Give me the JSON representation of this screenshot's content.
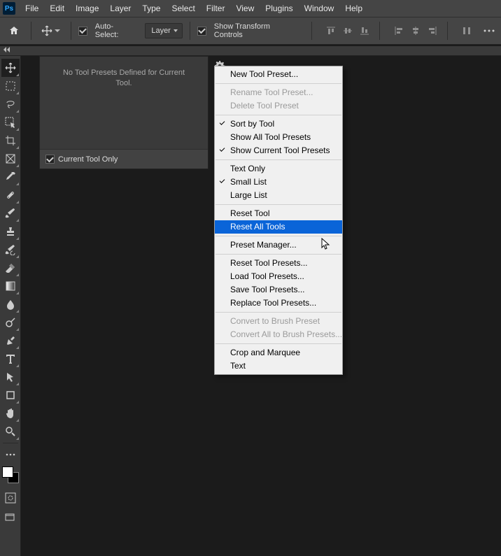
{
  "menubar": [
    "File",
    "Edit",
    "Image",
    "Layer",
    "Type",
    "Select",
    "Filter",
    "View",
    "Plugins",
    "Window",
    "Help"
  ],
  "optionsbar": {
    "auto_select_label": "Auto-Select:",
    "layer_dropdown": "Layer",
    "show_transform_label": "Show Transform Controls"
  },
  "preset_panel": {
    "empty_msg_line1": "No Tool Presets Defined for Current",
    "empty_msg_line2": "Tool.",
    "footer_checkbox": "Current Tool Only"
  },
  "context_menu": {
    "items": [
      {
        "label": "New Tool Preset...",
        "type": "item"
      },
      {
        "type": "sep"
      },
      {
        "label": "Rename Tool Preset...",
        "type": "item",
        "disabled": true
      },
      {
        "label": "Delete Tool Preset",
        "type": "item",
        "disabled": true
      },
      {
        "type": "sep"
      },
      {
        "label": "Sort by Tool",
        "type": "item",
        "checked": true
      },
      {
        "label": "Show All Tool Presets",
        "type": "item"
      },
      {
        "label": "Show Current Tool Presets",
        "type": "item",
        "checked": true
      },
      {
        "type": "sep"
      },
      {
        "label": "Text Only",
        "type": "item"
      },
      {
        "label": "Small List",
        "type": "item",
        "checked": true
      },
      {
        "label": "Large List",
        "type": "item"
      },
      {
        "type": "sep"
      },
      {
        "label": "Reset Tool",
        "type": "item"
      },
      {
        "label": "Reset All Tools",
        "type": "item",
        "highlight": true
      },
      {
        "type": "sep"
      },
      {
        "label": "Preset Manager...",
        "type": "item"
      },
      {
        "type": "sep"
      },
      {
        "label": "Reset Tool Presets...",
        "type": "item"
      },
      {
        "label": "Load Tool Presets...",
        "type": "item"
      },
      {
        "label": "Save Tool Presets...",
        "type": "item"
      },
      {
        "label": "Replace Tool Presets...",
        "type": "item"
      },
      {
        "type": "sep"
      },
      {
        "label": "Convert to Brush Preset",
        "type": "item",
        "disabled": true
      },
      {
        "label": "Convert All to Brush Presets...",
        "type": "item",
        "disabled": true
      },
      {
        "type": "sep"
      },
      {
        "label": "Crop and Marquee",
        "type": "item"
      },
      {
        "label": "Text",
        "type": "item"
      }
    ]
  }
}
